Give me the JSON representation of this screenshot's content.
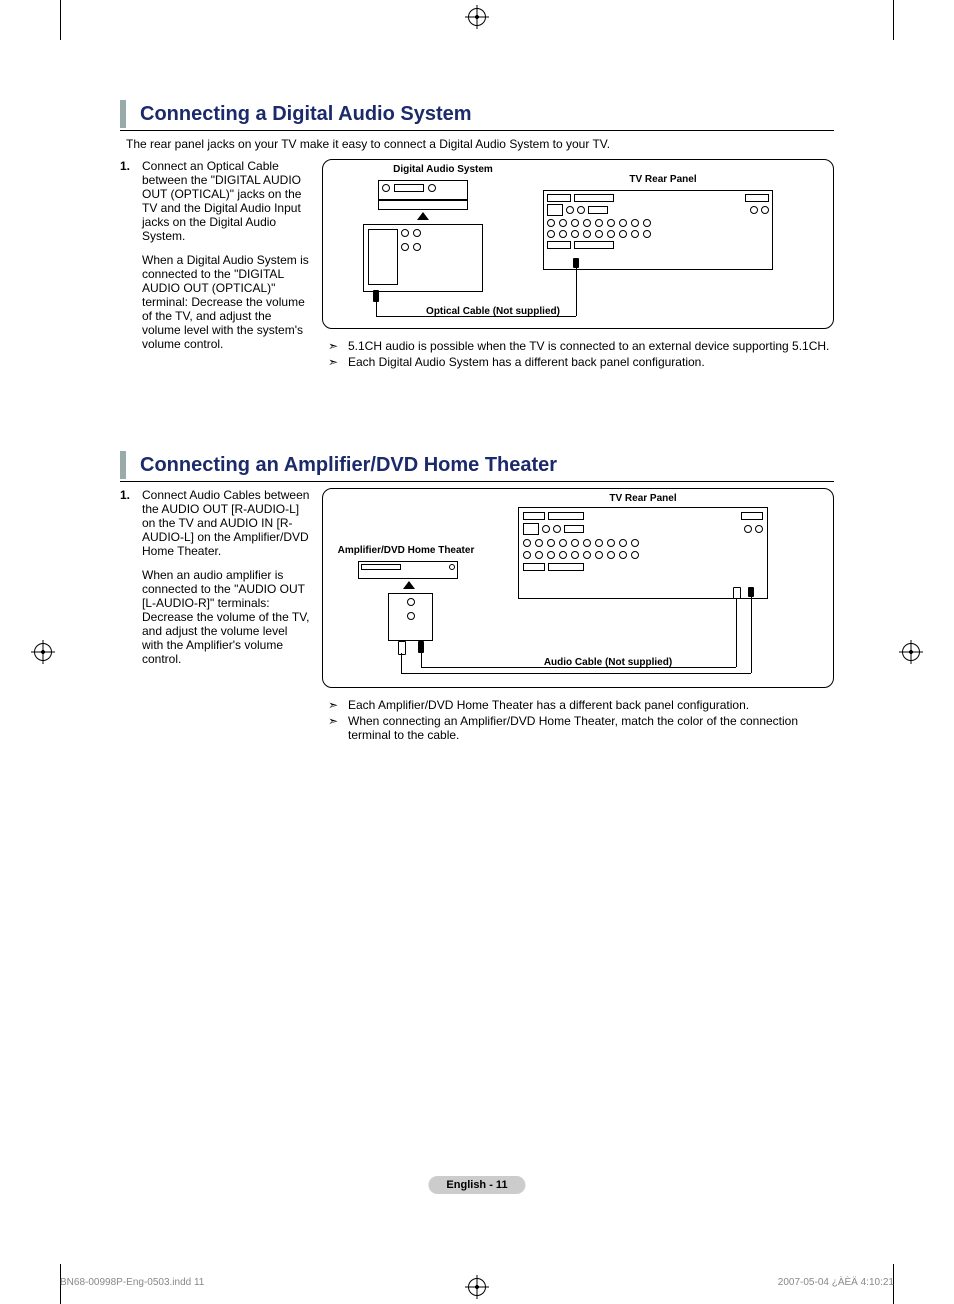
{
  "section1": {
    "title": "Connecting a Digital Audio System",
    "intro": "The rear panel jacks on your TV make it easy to connect a Digital Audio System to your TV.",
    "step_num": "1.",
    "step_p1": "Connect an Optical Cable between the \"DIGITAL AUDIO OUT (OPTICAL)\" jacks on the TV and the Digital Audio Input jacks on the Digital Audio System.",
    "step_p2": "When a Digital Audio System is connected to the \"DIGITAL AUDIO OUT (OPTICAL)\" terminal: Decrease the volume of the TV, and adjust the volume level with the system's volume control.",
    "diag_label_left": "Digital Audio System",
    "diag_label_right": "TV Rear Panel",
    "diag_cable": "Optical Cable (Not supplied)",
    "note1": "5.1CH audio is possible when the TV is connected to an external device supporting 5.1CH.",
    "note2": "Each Digital Audio System has a different back panel configuration."
  },
  "section2": {
    "title": "Connecting an Amplifier/DVD Home Theater",
    "step_num": "1.",
    "step_p1": "Connect Audio Cables between the AUDIO OUT [R-AUDIO-L] on the TV and AUDIO IN [R-AUDIO-L] on the Amplifier/DVD Home Theater.",
    "step_p2": "When an audio amplifier is connected to the \"AUDIO OUT [L-AUDIO-R]\" terminals: Decrease the volume of the TV, and adjust the volume level with the Amplifier's volume control.",
    "diag_label_left": "Amplifier/DVD Home Theater",
    "diag_label_right": "TV Rear Panel",
    "diag_cable": "Audio Cable (Not supplied)",
    "note1": "Each Amplifier/DVD Home Theater has a different back panel configuration.",
    "note2": "When connecting an Amplifier/DVD Home Theater, match the color of the connection terminal to the cable."
  },
  "page_label": "English - 11",
  "footer_left": "BN68-00998P-Eng-0503.indd   11",
  "footer_right": "2007-05-04   ¿ÀÈÄ 4:10:21"
}
